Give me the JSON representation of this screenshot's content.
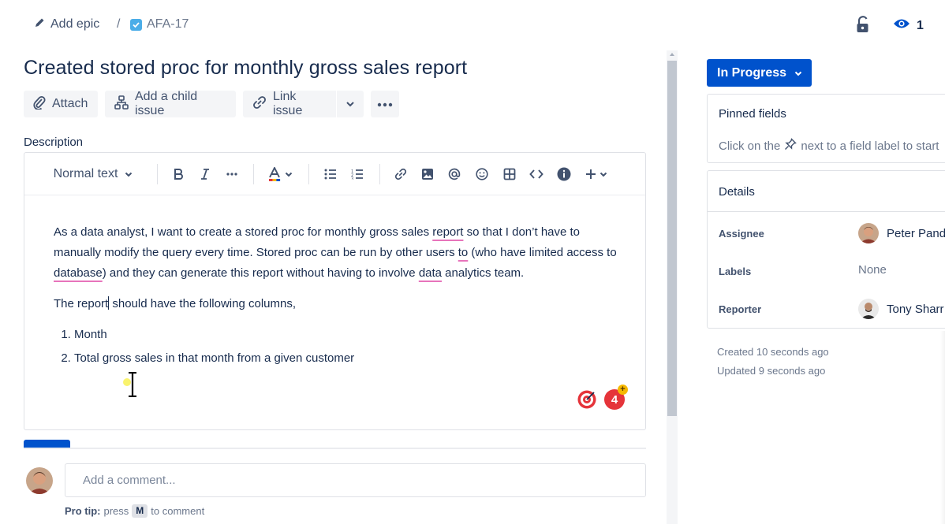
{
  "breadcrumb": {
    "add_epic": "Add epic",
    "separator": "/",
    "issue_key": "AFA-17"
  },
  "watchers": {
    "count": "1"
  },
  "issue": {
    "title": "Created stored proc for monthly gross sales report"
  },
  "actions": {
    "attach": "Attach",
    "add_child": "Add a child issue",
    "link_issue": "Link issue"
  },
  "description": {
    "label": "Description",
    "toolbar": {
      "text_style": "Normal text"
    },
    "paragraph1": {
      "a": "As a data analyst, I want to create a stored proc for monthly gross sales ",
      "w1": "report",
      "b": " so that I don’t have to manually modify the query every time. Stored proc can be run by other users ",
      "w2": "to",
      "c": " (who have limited access to ",
      "w3": "database",
      "d": ") and they can generate this report without having to involve ",
      "w4": "data",
      "e": " analytics team."
    },
    "paragraph2": {
      "a": "The report",
      "b": " should  have the following columns,"
    },
    "list": [
      "Month",
      "Total gross sales in that month from a given customer"
    ],
    "badge_count": "4",
    "badge_plus": "+"
  },
  "comment": {
    "placeholder": "Add a comment...",
    "protip_label": "Pro tip:",
    "protip_press": "press",
    "protip_key": "M",
    "protip_suffix": "to comment"
  },
  "sidebar": {
    "status": "In Progress",
    "pinned": {
      "title": "Pinned fields",
      "hint_a": "Click on the",
      "hint_b": "next to a field label to start"
    },
    "details": {
      "title": "Details",
      "assignee_label": "Assignee",
      "assignee_value": "Peter Pand",
      "labels_label": "Labels",
      "labels_value": "None",
      "reporter_label": "Reporter",
      "reporter_value": "Tony Sharr"
    },
    "created": "Created 10 seconds ago",
    "updated": "Updated 9 seconds ago"
  },
  "colors": {
    "primary": "#0052cc",
    "text": "#172b4d",
    "subtle": "#6b778c",
    "spelling_underline": "#e774bb"
  }
}
